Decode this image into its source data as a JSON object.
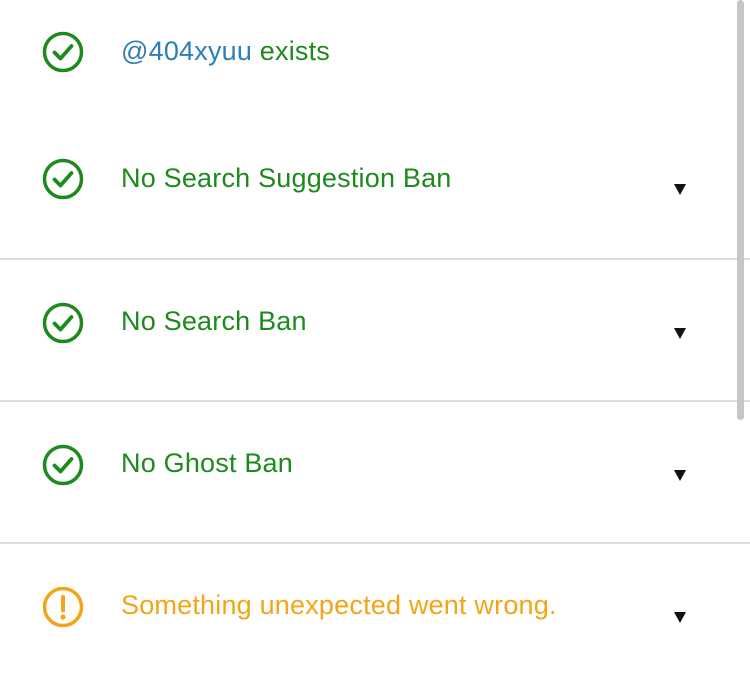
{
  "colors": {
    "ok": "#1e8a1e",
    "warning": "#f2a516",
    "handle_link": "#2e7db8",
    "chevron": "#111111",
    "divider": "#dcdcdc"
  },
  "account": {
    "handle": "@404xyuu",
    "exists_text": " exists",
    "status_icon": "check-circle-icon"
  },
  "checks": [
    {
      "label": "No Search Suggestion Ban",
      "status": "ok",
      "icon": "check-circle-icon",
      "expand_icon": "chevron-down-icon"
    },
    {
      "label": "No Search Ban",
      "status": "ok",
      "icon": "check-circle-icon",
      "expand_icon": "chevron-down-icon"
    },
    {
      "label": "No Ghost Ban",
      "status": "ok",
      "icon": "check-circle-icon",
      "expand_icon": "chevron-down-icon"
    },
    {
      "label": "Something unexpected went wrong.",
      "status": "warning",
      "icon": "warning-circle-icon",
      "expand_icon": "chevron-down-icon"
    }
  ]
}
